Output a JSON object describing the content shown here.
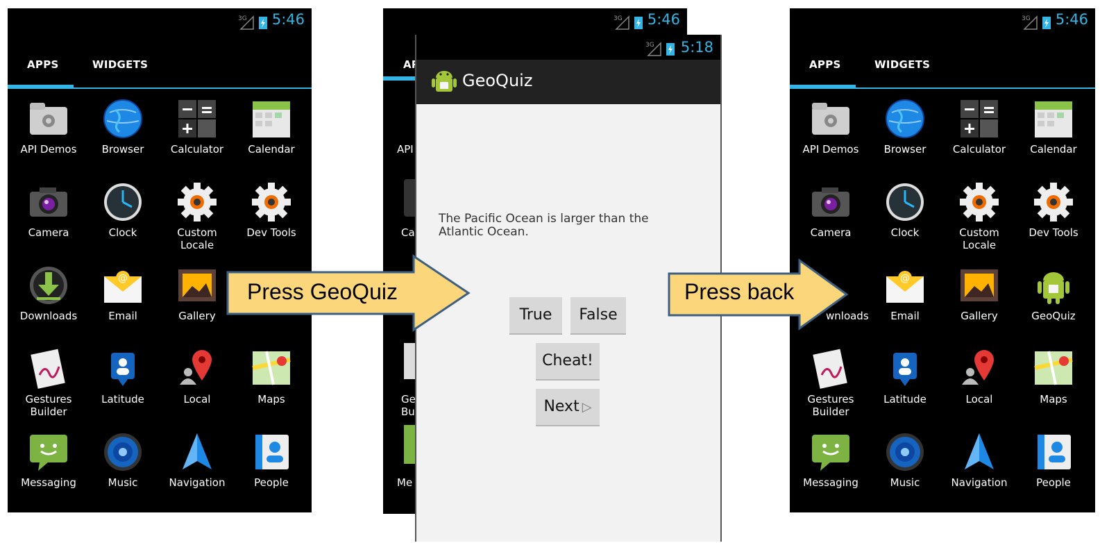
{
  "left_phone": {
    "status_time": "5:46",
    "tabs": [
      "APPS",
      "WIDGETS"
    ],
    "apps": [
      "API Demos",
      "Browser",
      "Calculator",
      "Calendar",
      "Camera",
      "Clock",
      "Custom\nLocale",
      "Dev Tools",
      "Downloads",
      "Email",
      "Gallery",
      "",
      "Gestures\nBuilder",
      "Latitude",
      "Local",
      "Maps",
      "Messaging",
      "Music",
      "Navigation",
      "People"
    ]
  },
  "middle_phone": {
    "back_status_time": "5:46",
    "back_tab_fragment": "AP",
    "back_label_fragments": [
      "API",
      "Ca",
      "Ge\nBu",
      "Me"
    ],
    "status_time": "5:18",
    "app_title": "GeoQuiz",
    "question": "The Pacific Ocean is larger than the Atlantic Ocean.",
    "buttons": {
      "true": "True",
      "false": "False",
      "cheat": "Cheat!",
      "next": "Next"
    }
  },
  "right_phone": {
    "status_time": "5:46",
    "tabs": [
      "APPS",
      "WIDGETS"
    ],
    "apps": [
      "API Demos",
      "Browser",
      "Calculator",
      "Calendar",
      "Camera",
      "Clock",
      "Custom\nLocale",
      "Dev Tools",
      "",
      "Email",
      "Gallery",
      "GeoQuiz",
      "Gestures\nBuilder",
      "Latitude",
      "Local",
      "Maps",
      "Messaging",
      "Music",
      "Navigation",
      "People"
    ],
    "downloads_fragment": "wnloads"
  },
  "arrows": {
    "first": "Press GeoQuiz",
    "second": "Press back"
  },
  "colors": {
    "accent": "#33b5e5",
    "arrow_fill": "#fbd67a",
    "arrow_border": "#3e5f82"
  },
  "icons": [
    "folder-gear-icon",
    "globe-icon",
    "calculator-icon",
    "calendar-icon",
    "camera-icon",
    "clock-icon",
    "gear-icon",
    "gear-icon",
    "download-icon",
    "email-icon",
    "gallery-icon",
    "android-icon",
    "gestures-icon",
    "latitude-icon",
    "map-pin-icon",
    "maps-icon",
    "messaging-icon",
    "speaker-icon",
    "navigation-icon",
    "contacts-icon"
  ]
}
